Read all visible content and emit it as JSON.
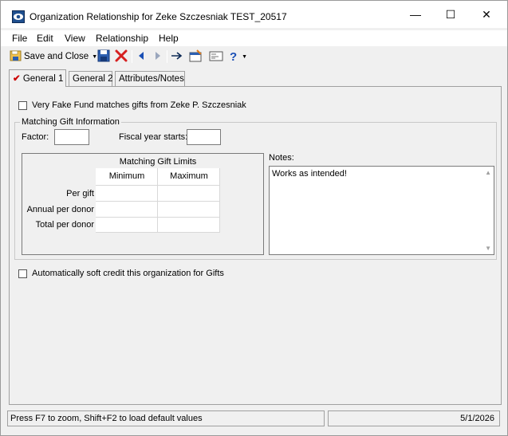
{
  "window": {
    "title": "Organization Relationship for Zeke Szczesniak TEST_20517",
    "minimize_glyph": "—",
    "maximize_glyph": "☐",
    "close_glyph": "✕"
  },
  "menu": [
    "File",
    "Edit",
    "View",
    "Relationship",
    "Help"
  ],
  "toolbar": {
    "save_and_close_label": "Save and Close",
    "icons": [
      "save-icon",
      "delete-icon",
      "previous-icon",
      "next-icon",
      "goto-icon",
      "properties-icon",
      "email-icon",
      "help-icon"
    ]
  },
  "tabs": [
    {
      "label": "General 1",
      "active": true
    },
    {
      "label": "General 2",
      "active": false
    },
    {
      "label": "Attributes/Notes",
      "active": false
    }
  ],
  "general1": {
    "matches_gifts_label": "Very Fake Fund matches gifts from Zeke P. Szczesniak",
    "matches_gifts_checked": false,
    "group_title": "Matching Gift Information",
    "factor_label": "Factor:",
    "factor_value": "",
    "fiscal_year_label": "Fiscal year starts:",
    "fiscal_year_value": "",
    "limits_title": "Matching Gift Limits",
    "limits_columns": [
      "Minimum",
      "Maximum"
    ],
    "limits_rows": [
      {
        "label": "Per gift",
        "min": "",
        "max": ""
      },
      {
        "label": "Annual per donor",
        "min": "",
        "max": ""
      },
      {
        "label": "Total per donor",
        "min": "",
        "max": ""
      }
    ],
    "notes_label": "Notes:",
    "notes_text": "Works as intended!",
    "soft_credit_label": "Automatically soft credit this organization for Gifts",
    "soft_credit_checked": false
  },
  "status": {
    "hint": "Press F7 to zoom, Shift+F2 to load default values",
    "middle": "",
    "date": "5/1/2026"
  },
  "colors": {
    "window_bg": "#f0f0f0",
    "delete_red": "#d62020",
    "nav_blue": "#1a4fb5",
    "check_red": "#cc0000"
  }
}
